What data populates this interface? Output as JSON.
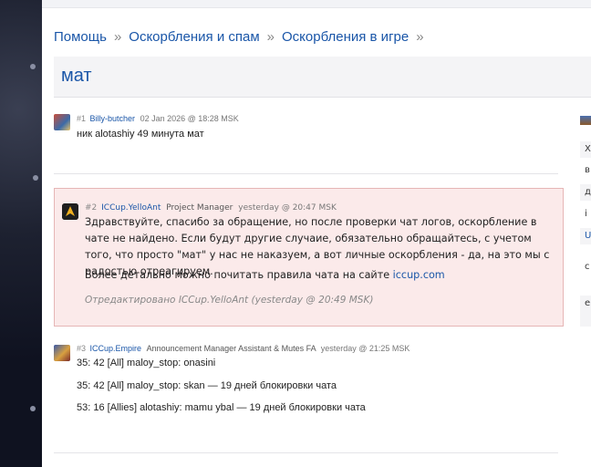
{
  "breadcrumb": [
    "Помощь",
    "Оскорбления и спам",
    "Оскорбления в игре"
  ],
  "breadcrumb_sep": "»",
  "page_title": "мат",
  "posts": [
    {
      "num": "#1",
      "author": "Billy-butcher",
      "role": "",
      "date": "02 Jan 2026 @ 18:28 MSK",
      "lines": [
        "ник alotashiy 49 минута мат"
      ]
    },
    {
      "num": "#2",
      "author": "ICCup.YelloAnt",
      "role": "Project Manager",
      "date": "yesterday @ 20:47 MSK",
      "paragraph1": "Здравствуйте, спасибо за обращение, но после проверки чат логов, оскорбление в чате не найдено. Если будут другие случаие, обязательно обращайтесь, с учетом того, что просто \"мат\" у нас не наказуем, а вот личные оскорбления - да, на это мы с радостью отреагируем.",
      "paragraph2_prefix": "Более детально можно почитать правила чата на сайте ",
      "paragraph2_link": "iccup.com",
      "edited": "Отредактировано ICCup.YelloAnt (yesterday @ 20:49 MSK)"
    },
    {
      "num": "#3",
      "author": "ICCup.Empire",
      "role": "Announcement Manager Assistant & Mutes FA",
      "date": "yesterday @ 21:25 MSK",
      "lines": [
        "35: 42 [All] maloy_stop: onasini",
        "35: 42 [All] maloy_stop: skan — 19 дней блокировки чата",
        "53: 16 [Allies] alotashiy: mamu ybal — 19 дней блокировки чата"
      ]
    }
  ],
  "sidebar": {
    "rows": [
      "Х",
      "в",
      "д",
      "i",
      "U",
      "с",
      "е"
    ]
  },
  "colors": {
    "link": "#1a56a8",
    "highlight_bg": "#fbeaea",
    "highlight_border": "#e6b6b6"
  }
}
